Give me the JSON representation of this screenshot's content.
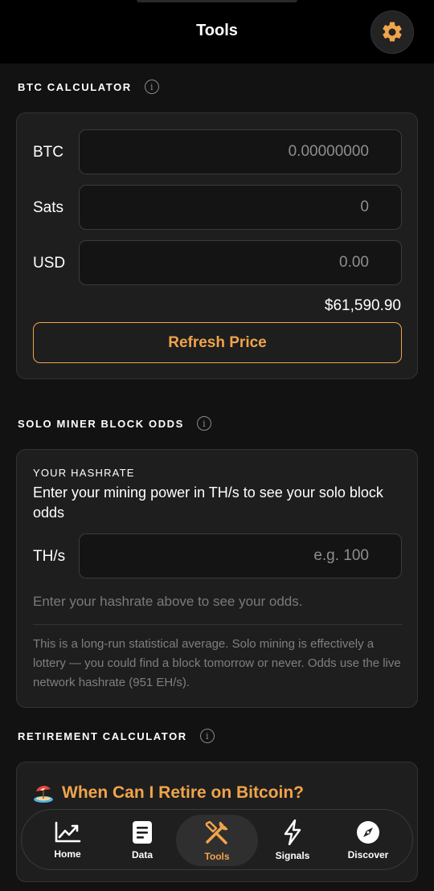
{
  "header": {
    "title": "Tools"
  },
  "btc_calculator": {
    "title": "BTC CALCULATOR",
    "info": "i",
    "rows": [
      {
        "label": "BTC",
        "placeholder": "0.00000000"
      },
      {
        "label": "Sats",
        "placeholder": "0"
      },
      {
        "label": "USD",
        "placeholder": "0.00"
      }
    ],
    "price": "$61,590.90",
    "refresh_label": "Refresh Price"
  },
  "solo_miner": {
    "title": "SOLO MINER BLOCK ODDS",
    "info": "i",
    "hashrate_heading": "YOUR HASHRATE",
    "description": "Enter your mining power in TH/s to see your solo block odds",
    "input_label": "TH/s",
    "input_placeholder": "e.g. 100",
    "hint": "Enter your hashrate above to see your odds.",
    "note": "This is a long-run statistical average. Solo mining is effectively a lottery — you could find a block tomorrow or never. Odds use the live network hashrate (951 EH/s)."
  },
  "retirement": {
    "title": "RETIREMENT CALCULATOR",
    "info": "i",
    "card_title": "When Can I Retire on Bitcoin?"
  },
  "tabbar": {
    "tabs": [
      {
        "label": "Home",
        "icon": "chart-up-icon"
      },
      {
        "label": "Data",
        "icon": "document-icon"
      },
      {
        "label": "Tools",
        "icon": "tools-icon",
        "active": true
      },
      {
        "label": "Signals",
        "icon": "lightning-icon"
      },
      {
        "label": "Discover",
        "icon": "compass-icon"
      }
    ]
  },
  "colors": {
    "accent": "#f0a44b",
    "background": "#121212",
    "card": "#1e1e1e"
  }
}
